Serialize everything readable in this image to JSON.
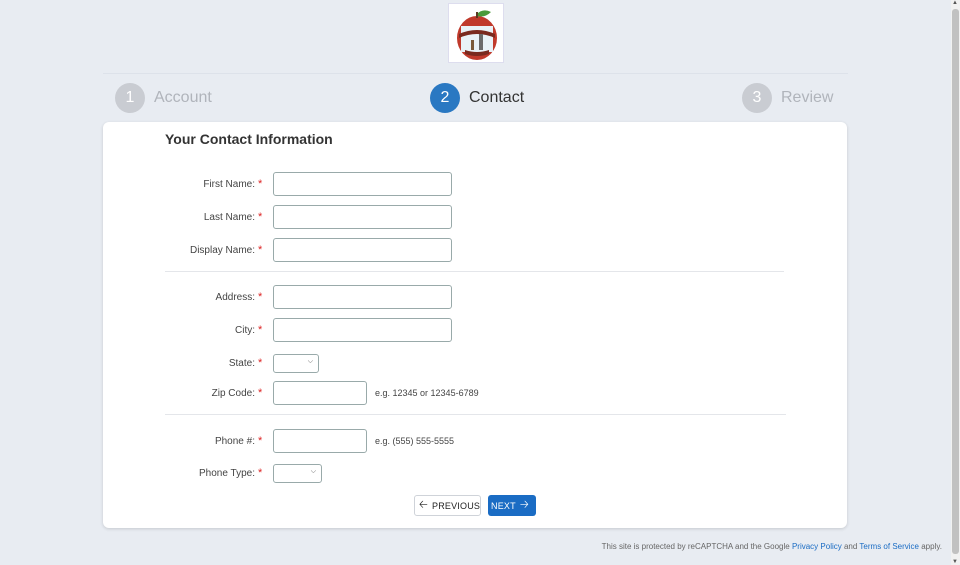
{
  "steps": [
    {
      "number": "1",
      "label": "Account"
    },
    {
      "number": "2",
      "label": "Contact"
    },
    {
      "number": "3",
      "label": "Review"
    }
  ],
  "form": {
    "title": "Your Contact Information",
    "first_name_label": "First Name:",
    "last_name_label": "Last Name:",
    "display_name_label": "Display Name:",
    "address_label": "Address:",
    "city_label": "City:",
    "state_label": "State:",
    "zip_label": "Zip Code:",
    "zip_hint": "e.g. 12345 or 12345-6789",
    "phone_label": "Phone #:",
    "phone_hint": "e.g. (555) 555-5555",
    "phone_type_label": "Phone Type:",
    "required_marker": "*"
  },
  "buttons": {
    "previous": "PREVIOUS",
    "next": "NEXT"
  },
  "footer": {
    "text_1": "This site is protected by reCAPTCHA and the Google",
    "privacy_link": "Privacy Policy",
    "text_2": "and",
    "terms_link": "Terms of Service",
    "text_3": "apply."
  },
  "colors": {
    "accent": "#2a78c2",
    "required": "#d22222",
    "page_background": "#e8ecf2"
  },
  "icons": [
    "logo-apple-emblem",
    "arrow-left-icon",
    "arrow-right-icon",
    "chevron-down-icon"
  ]
}
